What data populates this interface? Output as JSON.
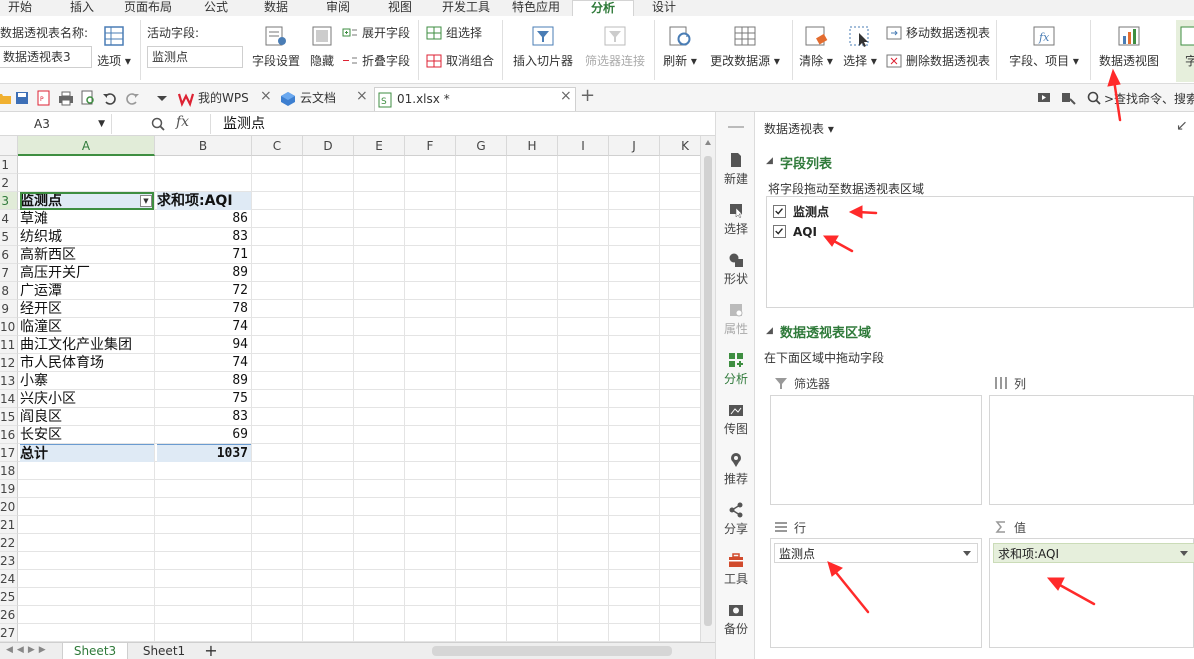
{
  "menu": {
    "tabs": [
      "开始",
      "插入",
      "页面布局",
      "公式",
      "数据",
      "审阅",
      "视图",
      "开发工具",
      "特色应用",
      "分析",
      "设计"
    ],
    "active_index": 9
  },
  "ribbon": {
    "pivot_name_label": "数据透视表名称:",
    "pivot_name_value": "数据透视表3",
    "options_label": "选项",
    "active_field_label": "活动字段:",
    "active_field_value": "监测点",
    "field_settings": "字段设置",
    "hide": "隐藏",
    "expand_field": "展开字段",
    "collapse_field": "折叠字段",
    "group_selection": "组选择",
    "ungroup": "取消组合",
    "insert_slicer": "插入切片器",
    "filter_connections": "筛选器连接",
    "refresh": "刷新",
    "change_data_source": "更改数据源",
    "clear": "清除",
    "select": "选择",
    "move_pivot": "移动数据透视表",
    "delete_pivot": "删除数据透视表",
    "fields_items": "字段、项目",
    "pivot_chart": "数据透视图",
    "field_list_partial": "字"
  },
  "quickbar": {
    "tabs": [
      {
        "label": "我的WPS",
        "icon": "wps-logo-icon"
      },
      {
        "label": "云文档",
        "icon": "cloud-doc-icon"
      },
      {
        "label": "01.xlsx *",
        "icon": "excel-file-icon"
      }
    ],
    "search_placeholder": ">查找命令、搜索"
  },
  "formula": {
    "cell_ref": "A3",
    "fx": "fx",
    "content": "监测点"
  },
  "sheet": {
    "columns": [
      "A",
      "B",
      "C",
      "D",
      "E",
      "F",
      "G",
      "H",
      "I",
      "J",
      "K"
    ],
    "row_numbers": [
      "1",
      "2",
      "3",
      "4",
      "5",
      "6",
      "7",
      "8",
      "9",
      "10",
      "11",
      "12",
      "13",
      "14",
      "15",
      "16",
      "17",
      "18",
      "19",
      "20",
      "21",
      "22",
      "23",
      "24",
      "25",
      "26",
      "27"
    ],
    "pivot_header": [
      "监测点",
      "求和项:AQI"
    ],
    "rows": [
      [
        "草滩",
        "86"
      ],
      [
        "纺织城",
        "83"
      ],
      [
        "高新西区",
        "71"
      ],
      [
        "高压开关厂",
        "89"
      ],
      [
        "广运潭",
        "72"
      ],
      [
        "经开区",
        "78"
      ],
      [
        "临潼区",
        "74"
      ],
      [
        "曲江文化产业集团",
        "94"
      ],
      [
        "市人民体育场",
        "74"
      ],
      [
        "小寨",
        "89"
      ],
      [
        "兴庆小区",
        "75"
      ],
      [
        "阎良区",
        "83"
      ],
      [
        "长安区",
        "69"
      ]
    ],
    "total": [
      "总计",
      "1037"
    ],
    "sheet_tabs": [
      "Sheet3",
      "Sheet1"
    ],
    "add_sheet": "+"
  },
  "dock": {
    "items": [
      "新建",
      "选择",
      "形状",
      "属性",
      "分析",
      "传图",
      "推荐",
      "分享",
      "工具",
      "备份"
    ]
  },
  "pane": {
    "title": "数据透视表",
    "field_list_title": "字段列表",
    "field_list_hint": "将字段拖动至数据透视表区域",
    "fields": [
      {
        "label": "监测点",
        "checked": true
      },
      {
        "label": "AQI",
        "checked": true
      }
    ],
    "area_title": "数据透视表区域",
    "area_hint": "在下面区域中拖动字段",
    "filter_label": "筛选器",
    "column_label": "列",
    "row_label": "行",
    "value_label": "值",
    "row_chip": "监测点",
    "value_chip": "求和项:AQI"
  },
  "colors": {
    "accent": "#2f7a3a",
    "annotation": "#ff2a2a",
    "selected_header_bg": "#e1ecd8",
    "value_chip_bg": "#e6efdc"
  }
}
